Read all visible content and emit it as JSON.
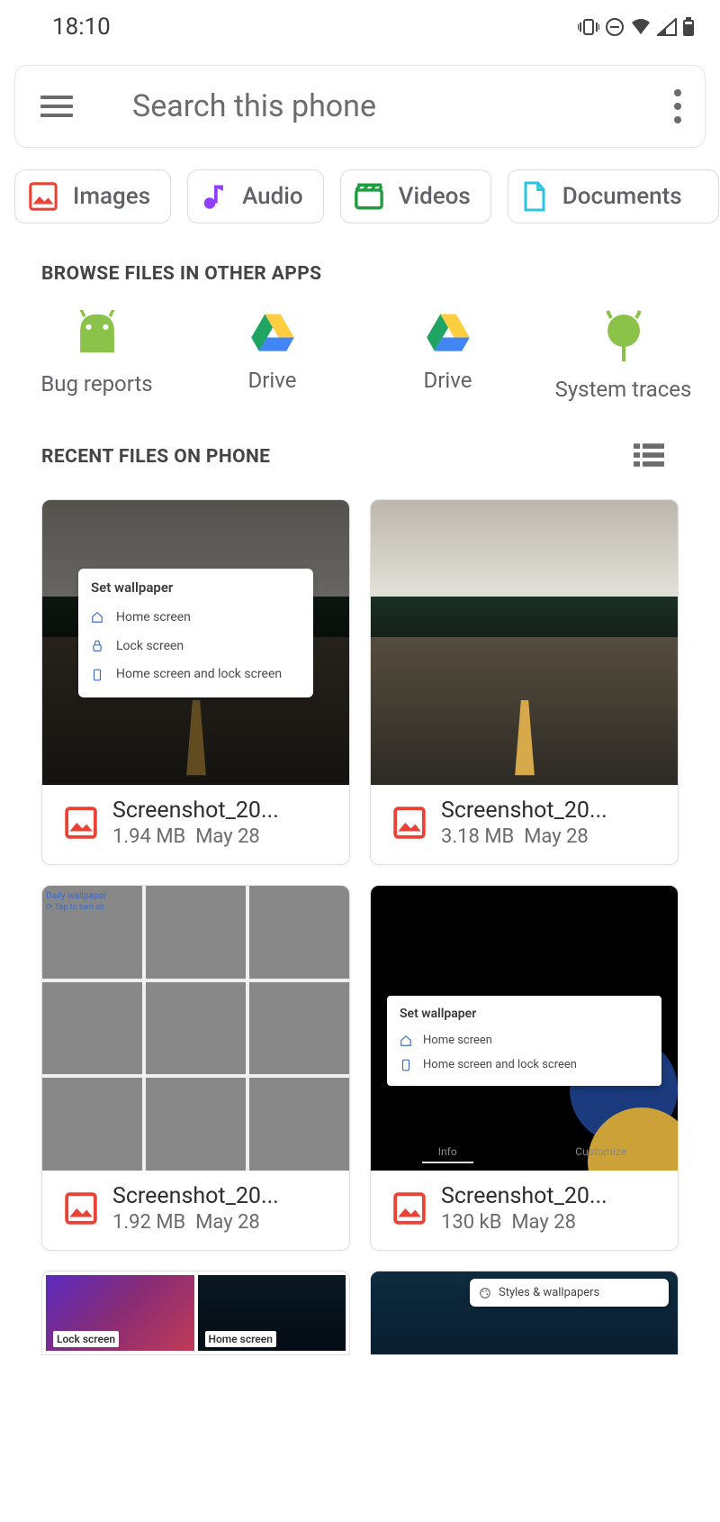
{
  "status": {
    "time": "18:10"
  },
  "search": {
    "placeholder": "Search this phone"
  },
  "categories": [
    {
      "label": "Images"
    },
    {
      "label": "Audio"
    },
    {
      "label": "Videos"
    },
    {
      "label": "Documents"
    }
  ],
  "section_browse": "BROWSE FILES IN OTHER APPS",
  "apps": [
    {
      "label": "Bug reports"
    },
    {
      "label": "Drive"
    },
    {
      "label": "Drive"
    },
    {
      "label": "System traces"
    }
  ],
  "section_recent": "RECENT FILES ON PHONE",
  "files": [
    {
      "name": "Screenshot_20...",
      "size": "1.94 MB",
      "date": "May 28",
      "dialog": {
        "title": "Set wallpaper",
        "opts": [
          "Home screen",
          "Lock screen",
          "Home screen and lock screen"
        ]
      }
    },
    {
      "name": "Screenshot_20...",
      "size": "3.18 MB",
      "date": "May 28"
    },
    {
      "name": "Screenshot_20...",
      "size": "1.92 MB",
      "date": "May 28",
      "daily": {
        "title": "Daily wallpaper",
        "sub": "Tap to turn on"
      }
    },
    {
      "name": "Screenshot_20...",
      "size": "130 kB",
      "date": "May 28",
      "dialog": {
        "title": "Set wallpaper",
        "opts": [
          "Home screen",
          "Home screen and lock screen"
        ]
      },
      "tabs": [
        "Info",
        "Customize"
      ]
    }
  ],
  "partial": {
    "lock": "Lock screen",
    "home": "Home screen",
    "styles": "Styles & wallpapers"
  }
}
